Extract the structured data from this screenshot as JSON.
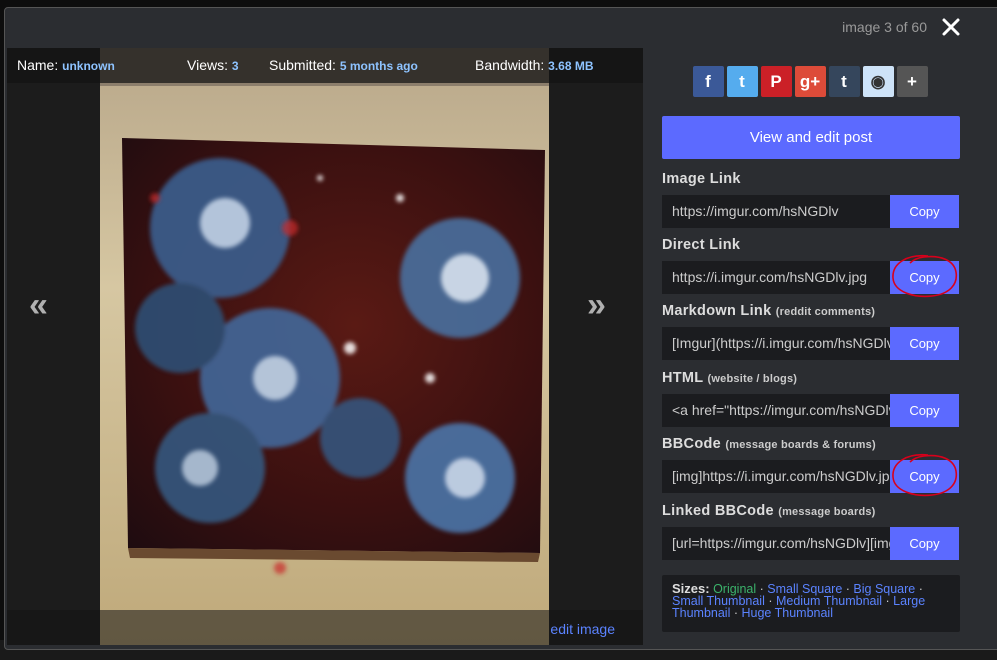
{
  "counter": "image 3 of 60",
  "stats": {
    "name_label": "Name:",
    "name_value": "unknown",
    "views_label": "Views:",
    "views_value": "3",
    "submitted_label": "Submitted:",
    "submitted_value": "5 months ago",
    "bandwidth_label": "Bandwidth:",
    "bandwidth_value": "3.68 MB"
  },
  "nav": {
    "prev": "«",
    "next": "»"
  },
  "edit_image": "edit image",
  "share": [
    {
      "icon": "facebook-icon",
      "glyph": "f",
      "color": "#3b5998"
    },
    {
      "icon": "twitter-icon",
      "glyph": "t",
      "color": "#55acee"
    },
    {
      "icon": "pinterest-icon",
      "glyph": "P",
      "color": "#cb2027"
    },
    {
      "icon": "googleplus-icon",
      "glyph": "g+",
      "color": "#dd4b39"
    },
    {
      "icon": "tumblr-icon",
      "glyph": "t",
      "color": "#35465c"
    },
    {
      "icon": "reddit-icon",
      "glyph": "◉",
      "color": "#cee3f8"
    },
    {
      "icon": "more-icon",
      "glyph": "+",
      "color": "#555"
    }
  ],
  "view_edit_post": "View and edit post",
  "links": [
    {
      "label": "Image Link",
      "note": "",
      "value": "https://imgur.com/hsNGDlv",
      "copy": "Copy",
      "circled": false
    },
    {
      "label": "Direct Link",
      "note": "",
      "value": "https://i.imgur.com/hsNGDlv.jpg",
      "copy": "Copy",
      "circled": true
    },
    {
      "label": "Markdown Link",
      "note": "(reddit comments)",
      "value": "[Imgur](https://i.imgur.com/hsNGDlv.jpg)",
      "copy": "Copy",
      "circled": false
    },
    {
      "label": "HTML",
      "note": "(website / blogs)",
      "value": "<a href=\"https://imgur.com/hsNGDlv\">",
      "copy": "Copy",
      "circled": false
    },
    {
      "label": "BBCode",
      "note": "(message boards & forums)",
      "value": "[img]https://i.imgur.com/hsNGDlv.jpg[/img]",
      "copy": "Copy",
      "circled": true
    },
    {
      "label": "Linked BBCode",
      "note": "(message boards)",
      "value": "[url=https://imgur.com/hsNGDlv][img]",
      "copy": "Copy",
      "circled": false
    }
  ],
  "sizes": {
    "title": "Sizes:",
    "original": "Original",
    "options": [
      "Small Square",
      "Big Square",
      "Small Thumbnail",
      "Medium Thumbnail",
      "Large Thumbnail",
      "Huge Thumbnail"
    ],
    "separator": " · "
  },
  "colors": {
    "accent": "#5c6aff",
    "annotation": "#d9001b",
    "original_green": "#3bb36b",
    "link_blue": "#5b83ff"
  }
}
